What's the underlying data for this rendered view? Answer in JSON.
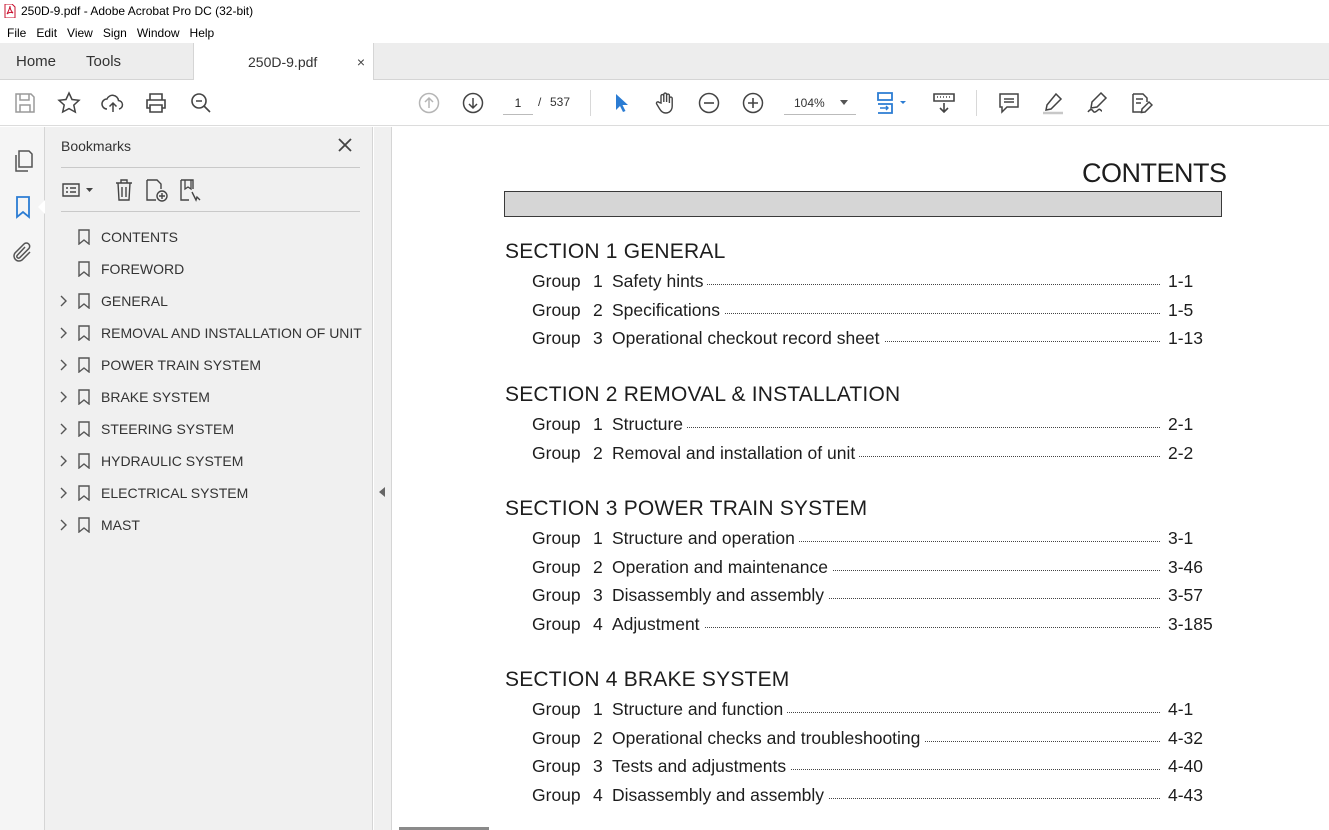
{
  "window": {
    "title": "250D-9.pdf - Adobe Acrobat Pro DC (32-bit)"
  },
  "menu": [
    "File",
    "Edit",
    "View",
    "Sign",
    "Window",
    "Help"
  ],
  "tabs": {
    "home": "Home",
    "tools": "Tools",
    "document": "250D-9.pdf",
    "close_glyph": "×"
  },
  "toolbar": {
    "icons": [
      "save-icon",
      "star-icon",
      "upload-icon",
      "print-icon",
      "find-icon",
      "prev-page-icon",
      "next-page-icon",
      "select-cursor-icon",
      "hand-icon",
      "zoom-out-icon",
      "zoom-in-icon",
      "page-layout-icon",
      "scroll-mode-icon",
      "comment-icon",
      "highlight-icon",
      "sign-icon",
      "edit-icon"
    ],
    "current_page": "1",
    "page_separator": "/",
    "total_pages": "537",
    "zoom": "104%"
  },
  "accent_color": "#2b7cd3",
  "bookmarks": {
    "title": "Bookmarks",
    "items": [
      {
        "label": "CONTENTS",
        "expandable": false
      },
      {
        "label": "FOREWORD",
        "expandable": false
      },
      {
        "label": "GENERAL",
        "expandable": true
      },
      {
        "label": "REMOVAL AND INSTALLATION OF UNIT",
        "expandable": true
      },
      {
        "label": "POWER TRAIN SYSTEM",
        "expandable": true
      },
      {
        "label": "BRAKE SYSTEM",
        "expandable": true
      },
      {
        "label": "STEERING SYSTEM",
        "expandable": true
      },
      {
        "label": "HYDRAULIC SYSTEM",
        "expandable": true
      },
      {
        "label": "ELECTRICAL SYSTEM",
        "expandable": true
      },
      {
        "label": "MAST",
        "expandable": true
      }
    ]
  },
  "document": {
    "heading": "CONTENTS",
    "sections": [
      {
        "title": "SECTION  1  GENERAL",
        "groups": [
          {
            "label": "Group",
            "num": "1",
            "title": "Safety hints",
            "page": "1-1"
          },
          {
            "label": "Group",
            "num": "2",
            "title": "Specifications",
            "page": "1-5"
          },
          {
            "label": "Group",
            "num": "3",
            "title": "Operational checkout record sheet",
            "page": "1-13"
          }
        ]
      },
      {
        "title": "SECTION  2  REMOVAL & INSTALLATION",
        "groups": [
          {
            "label": "Group",
            "num": "1",
            "title": "Structure",
            "page": "2-1"
          },
          {
            "label": "Group",
            "num": "2",
            "title": "Removal and installation of unit",
            "page": "2-2"
          }
        ]
      },
      {
        "title": "SECTION  3  POWER TRAIN SYSTEM",
        "groups": [
          {
            "label": "Group",
            "num": "1",
            "title": "Structure and operation",
            "page": "3-1"
          },
          {
            "label": "Group",
            "num": "2",
            "title": "Operation and maintenance",
            "page": "3-46"
          },
          {
            "label": "Group",
            "num": "3",
            "title": "Disassembly and assembly",
            "page": "3-57"
          },
          {
            "label": "Group",
            "num": "4",
            "title": "Adjustment",
            "page": "3-185"
          }
        ]
      },
      {
        "title": "SECTION  4  BRAKE SYSTEM",
        "groups": [
          {
            "label": "Group",
            "num": "1",
            "title": "Structure and function",
            "page": "4-1"
          },
          {
            "label": "Group",
            "num": "2",
            "title": "Operational checks and troubleshooting",
            "page": "4-32"
          },
          {
            "label": "Group",
            "num": "3",
            "title": "Tests and adjustments",
            "page": "4-40"
          },
          {
            "label": "Group",
            "num": "4",
            "title": "Disassembly and assembly",
            "page": "4-43"
          }
        ]
      }
    ]
  }
}
